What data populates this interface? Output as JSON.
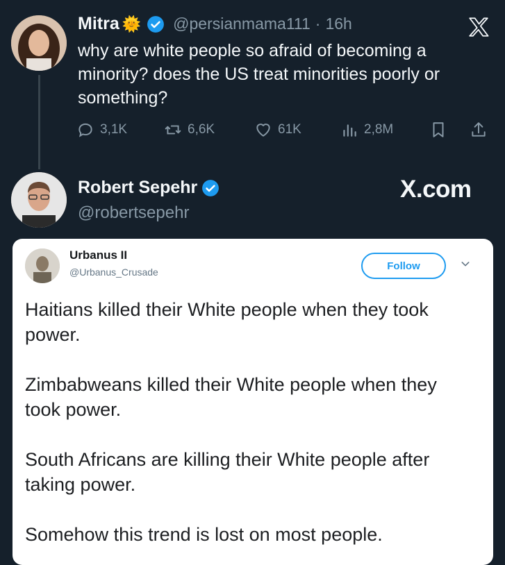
{
  "tweet": {
    "name": "Mitra",
    "emoji": "🌞",
    "handle": "@persianmama111",
    "separator": "·",
    "time": "16h",
    "text": "why are white people so afraid of becoming a minority? does the US treat minorities poorly or something?",
    "metrics": {
      "replies": "3,1K",
      "reposts": "6,6K",
      "likes": "61K",
      "views": "2,8M"
    }
  },
  "reply": {
    "name": "Robert Sepehr",
    "handle": "@robertsepehr",
    "watermark": "X.com"
  },
  "embedded": {
    "name": "Urbanus II",
    "handle": "@Urbanus_Crusade",
    "follow_label": "Follow",
    "paragraphs": [
      "Haitians killed their White people when they took power.",
      "Zimbabweans killed their White people when they took power.",
      "South Africans are killing their White people after taking power.",
      "Somehow this trend is lost on most people."
    ]
  },
  "colors": {
    "background": "#15202b",
    "verified": "#1d9bf0",
    "muted": "#8899a6",
    "card": "#ffffff"
  },
  "icons": [
    "x-logo-icon",
    "verified-badge-icon",
    "reply-icon",
    "repost-icon",
    "like-icon",
    "views-icon",
    "bookmark-icon",
    "share-icon",
    "chevron-down-icon"
  ]
}
